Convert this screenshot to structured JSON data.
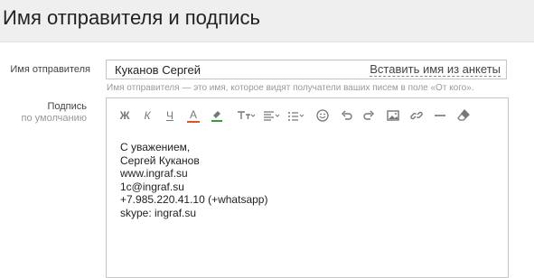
{
  "header": {
    "title": "Имя отправителя и подпись"
  },
  "sender": {
    "label": "Имя отправителя",
    "value": "Куканов Сергей",
    "fill_link": "Вставить имя из анкеты",
    "hint": "Имя отправителя — это имя, которое видят получатели ваших писем в поле «От кого»."
  },
  "signature": {
    "label_line1": "Подпись",
    "label_line2": "по умолчанию",
    "toolbar": {
      "bold": "Ж",
      "italic": "К",
      "underline": "Ч",
      "text_color": "A",
      "bg_color": "highlighter-icon",
      "font_size": "font-size-icon",
      "align": "align-icon",
      "list": "list-icon",
      "emoji": "smile-icon",
      "undo": "undo-icon",
      "redo": "redo-icon",
      "image": "image-icon",
      "link": "link-icon",
      "hr": "horizontal-line-icon",
      "clear": "eraser-icon"
    },
    "content_lines": [
      "С уважением,",
      "Сергей Куканов",
      "www.ingraf.su",
      "1c@ingraf.su",
      "+7.985.220.41.10 (+whatsapp)",
      "skype: ingraf.su"
    ]
  },
  "colors": {
    "header_bg": "#efefef",
    "text_color_icon": "#e0521f",
    "highlighter_icon": "#3a9a33",
    "border": "#c5c5c5"
  }
}
